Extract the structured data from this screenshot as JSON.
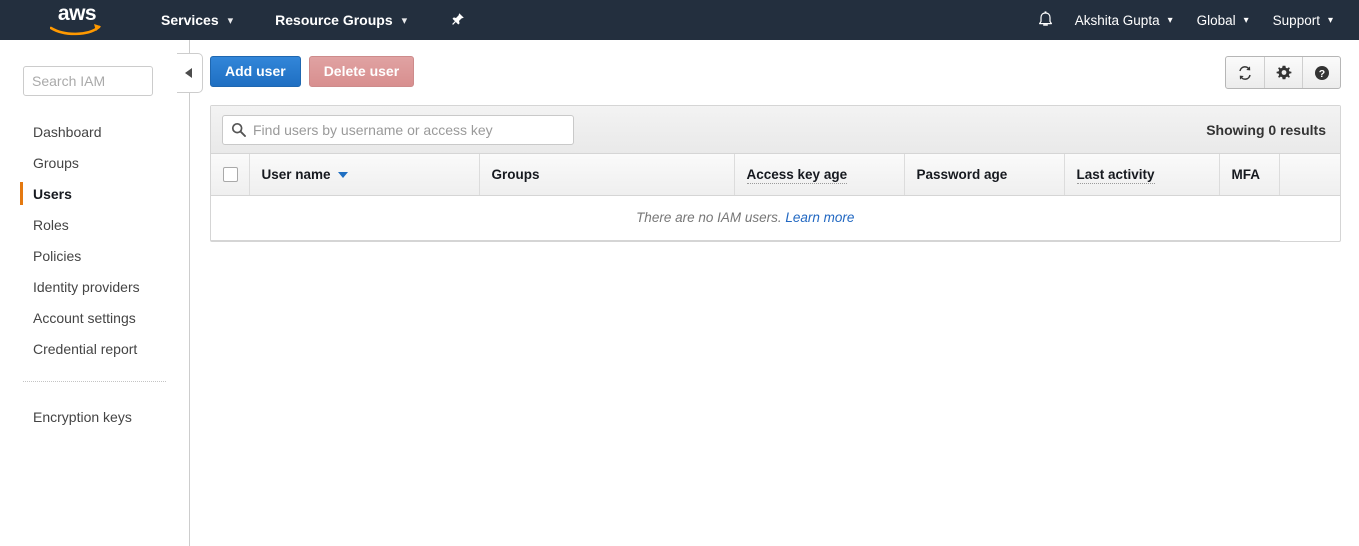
{
  "topnav": {
    "logo_alt": "aws",
    "services_label": "Services",
    "resource_groups_label": "Resource Groups",
    "pin_icon": "pin-icon",
    "bell_icon": "bell-icon",
    "account_label": "Akshita Gupta",
    "region_label": "Global",
    "support_label": "Support",
    "caret": "⌄",
    "background": "#232f3e",
    "logo_accent": "#ff9900"
  },
  "sidebar": {
    "search_placeholder": "Search IAM",
    "search_value": "",
    "items": [
      {
        "label": "Dashboard",
        "active": false
      },
      {
        "label": "Groups",
        "active": false
      },
      {
        "label": "Users",
        "active": true
      },
      {
        "label": "Roles",
        "active": false
      },
      {
        "label": "Policies",
        "active": false
      },
      {
        "label": "Identity providers",
        "active": false
      },
      {
        "label": "Account settings",
        "active": false
      },
      {
        "label": "Credential report",
        "active": false
      }
    ],
    "secondary_items": [
      {
        "label": "Encryption keys",
        "active": false
      }
    ],
    "active_marker_color": "#e47911",
    "collapse_icon": "chevron-left-icon"
  },
  "toolbar": {
    "add_user_label": "Add user",
    "delete_user_label": "Delete user",
    "add_user_color": "#2579ce",
    "delete_user_color": "#dd9a9a",
    "refresh_icon": "refresh-icon",
    "settings_icon": "gear-icon",
    "help_icon": "help-icon"
  },
  "table_toolbar": {
    "search_placeholder": "Find users by username or access key",
    "search_value": "",
    "search_icon": "search-icon",
    "results_text": "Showing 0 results"
  },
  "table": {
    "columns": [
      {
        "label": "User name",
        "sorted": true,
        "hint": false
      },
      {
        "label": "Groups",
        "sorted": false,
        "hint": false
      },
      {
        "label": "Access key age",
        "sorted": false,
        "hint": true
      },
      {
        "label": "Password age",
        "sorted": false,
        "hint": false
      },
      {
        "label": "Last activity",
        "sorted": false,
        "hint": true
      },
      {
        "label": "MFA",
        "sorted": false,
        "hint": false
      }
    ],
    "rows": [],
    "empty_message": "There are no IAM users.",
    "empty_link": "Learn more",
    "sort_caret_color": "#1f6fc2"
  }
}
